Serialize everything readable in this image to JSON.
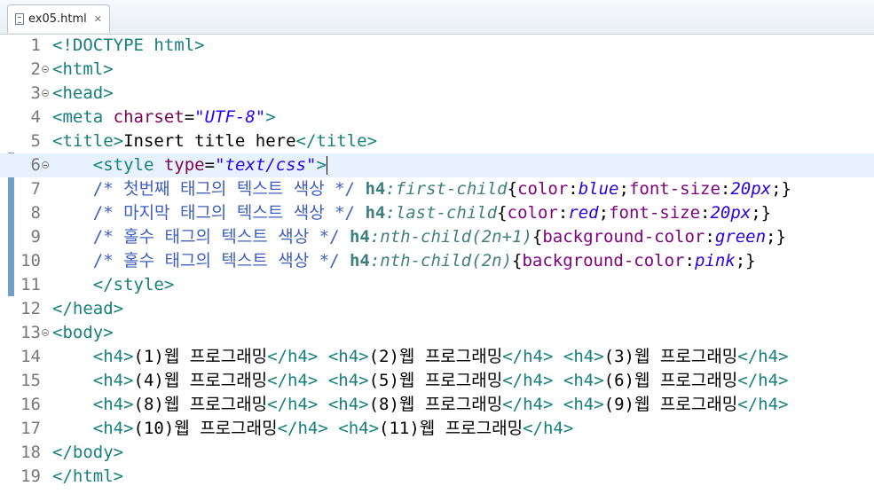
{
  "tab": {
    "title": "ex05.html",
    "close_glyph": "✕",
    "icon": "html-file-icon"
  },
  "lines": [
    {
      "n": "1",
      "fold": false,
      "indent": "",
      "segs": [
        [
          "t",
          "<!DOCTYPE html>"
        ]
      ]
    },
    {
      "n": "2",
      "fold": true,
      "indent": "",
      "segs": [
        [
          "t",
          "<html>"
        ]
      ]
    },
    {
      "n": "3",
      "fold": true,
      "indent": "",
      "segs": [
        [
          "t",
          "<head>"
        ]
      ]
    },
    {
      "n": "4",
      "fold": false,
      "indent": "",
      "segs": [
        [
          "t",
          "<meta "
        ],
        [
          "a",
          "charset"
        ],
        [
          "x",
          "="
        ],
        [
          "v",
          "\"UTF-8\""
        ],
        [
          "t",
          ">"
        ]
      ]
    },
    {
      "n": "5",
      "fold": false,
      "indent": "",
      "segs": [
        [
          "t",
          "<title>"
        ],
        [
          "x",
          "Insert title here"
        ],
        [
          "t",
          "</title>"
        ]
      ]
    },
    {
      "n": "6",
      "fold": true,
      "current": true,
      "caret": true,
      "indent": "    ",
      "segs": [
        [
          "t",
          "<style "
        ],
        [
          "a",
          "type"
        ],
        [
          "x",
          "="
        ],
        [
          "v",
          "\"text/css\""
        ],
        [
          "t",
          ">"
        ]
      ]
    },
    {
      "n": "7",
      "fold": false,
      "indent": "    ",
      "segs": [
        [
          "c",
          "/* 첫번째 태그의 텍스트 색상 */ "
        ],
        [
          "sel",
          "h4"
        ],
        [
          "ps",
          ":first-child"
        ],
        [
          "x",
          "{"
        ],
        [
          "p",
          "color"
        ],
        [
          "x",
          ":"
        ],
        [
          "pv",
          "blue"
        ],
        [
          "x",
          ";"
        ],
        [
          "p",
          "font-size"
        ],
        [
          "x",
          ":"
        ],
        [
          "pv",
          "20px"
        ],
        [
          "x",
          ";}"
        ]
      ]
    },
    {
      "n": "8",
      "fold": false,
      "indent": "    ",
      "segs": [
        [
          "c",
          "/* 마지막 태그의 텍스트 색상 */ "
        ],
        [
          "sel",
          "h4"
        ],
        [
          "ps",
          ":last-child"
        ],
        [
          "x",
          "{"
        ],
        [
          "p",
          "color"
        ],
        [
          "x",
          ":"
        ],
        [
          "pv",
          "red"
        ],
        [
          "x",
          ";"
        ],
        [
          "p",
          "font-size"
        ],
        [
          "x",
          ":"
        ],
        [
          "pv",
          "20px"
        ],
        [
          "x",
          ";}"
        ]
      ]
    },
    {
      "n": "9",
      "fold": false,
      "indent": "    ",
      "segs": [
        [
          "c",
          "/* 홀수 태그의 텍스트 색상 */ "
        ],
        [
          "sel",
          "h4"
        ],
        [
          "ps",
          ":nth-child(2n+1)"
        ],
        [
          "x",
          "{"
        ],
        [
          "p",
          "background-color"
        ],
        [
          "x",
          ":"
        ],
        [
          "pv",
          "green"
        ],
        [
          "x",
          ";}"
        ]
      ]
    },
    {
      "n": "10",
      "fold": false,
      "indent": "    ",
      "segs": [
        [
          "c",
          "/* 홀수 태그의 텍스트 색상 */ "
        ],
        [
          "sel",
          "h4"
        ],
        [
          "ps",
          ":nth-child(2n)"
        ],
        [
          "x",
          "{"
        ],
        [
          "p",
          "background-color"
        ],
        [
          "x",
          ":"
        ],
        [
          "pv",
          "pink"
        ],
        [
          "x",
          ";}"
        ]
      ]
    },
    {
      "n": "11",
      "fold": false,
      "indent": "    ",
      "segs": [
        [
          "t",
          "</style>"
        ]
      ]
    },
    {
      "n": "12",
      "fold": false,
      "indent": "",
      "segs": [
        [
          "t",
          "</head>"
        ]
      ]
    },
    {
      "n": "13",
      "fold": true,
      "indent": "",
      "segs": [
        [
          "t",
          "<body>"
        ]
      ]
    },
    {
      "n": "14",
      "fold": false,
      "indent": "    ",
      "segs": [
        [
          "t",
          "<h4>"
        ],
        [
          "x",
          "(1)웹 프로그래밍"
        ],
        [
          "t",
          "</h4>"
        ],
        [
          "x",
          " "
        ],
        [
          "t",
          "<h4>"
        ],
        [
          "x",
          "(2)웹 프로그래밍"
        ],
        [
          "t",
          "</h4>"
        ],
        [
          "x",
          " "
        ],
        [
          "t",
          "<h4>"
        ],
        [
          "x",
          "(3)웹 프로그래밍"
        ],
        [
          "t",
          "</h4>"
        ]
      ]
    },
    {
      "n": "15",
      "fold": false,
      "indent": "    ",
      "segs": [
        [
          "t",
          "<h4>"
        ],
        [
          "x",
          "(4)웹 프로그래밍"
        ],
        [
          "t",
          "</h4>"
        ],
        [
          "x",
          " "
        ],
        [
          "t",
          "<h4>"
        ],
        [
          "x",
          "(5)웹 프로그래밍"
        ],
        [
          "t",
          "</h4>"
        ],
        [
          "x",
          " "
        ],
        [
          "t",
          "<h4>"
        ],
        [
          "x",
          "(6)웹 프로그래밍"
        ],
        [
          "t",
          "</h4>"
        ]
      ]
    },
    {
      "n": "16",
      "fold": false,
      "indent": "    ",
      "segs": [
        [
          "t",
          "<h4>"
        ],
        [
          "x",
          "(8)웹 프로그래밍"
        ],
        [
          "t",
          "</h4>"
        ],
        [
          "x",
          " "
        ],
        [
          "t",
          "<h4>"
        ],
        [
          "x",
          "(8)웹 프로그래밍"
        ],
        [
          "t",
          "</h4>"
        ],
        [
          "x",
          " "
        ],
        [
          "t",
          "<h4>"
        ],
        [
          "x",
          "(9)웹 프로그래밍"
        ],
        [
          "t",
          "</h4>"
        ]
      ]
    },
    {
      "n": "17",
      "fold": false,
      "indent": "    ",
      "segs": [
        [
          "t",
          "<h4>"
        ],
        [
          "x",
          "(10)웹 프로그래밍"
        ],
        [
          "t",
          "</h4>"
        ],
        [
          "x",
          " "
        ],
        [
          "t",
          "<h4>"
        ],
        [
          "x",
          "(11)웹 프로그래밍"
        ],
        [
          "t",
          "</h4>"
        ]
      ]
    },
    {
      "n": "18",
      "fold": false,
      "indent": "",
      "segs": [
        [
          "t",
          "</body>"
        ]
      ]
    },
    {
      "n": "19",
      "fold": false,
      "indent": "",
      "segs": [
        [
          "t",
          "</html>"
        ]
      ]
    }
  ]
}
